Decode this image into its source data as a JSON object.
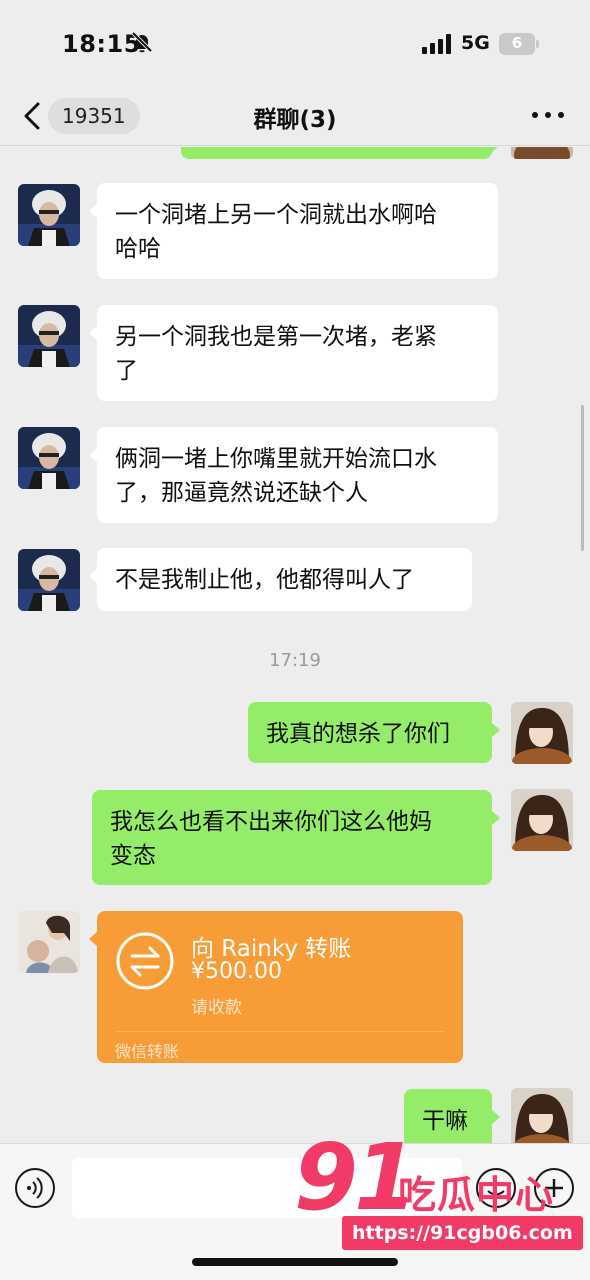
{
  "status_bar": {
    "time": "18:15",
    "network": "5G",
    "battery": "6",
    "icons": [
      "bell-slash-icon",
      "signal-bars-icon",
      "battery-icon"
    ]
  },
  "header": {
    "back_badge": "19351",
    "title": "群聊(3)",
    "more_icon": "ellipsis-icon"
  },
  "messages": [
    {
      "side": "left",
      "text": "一个洞堵上另一个洞就出水啊哈\n哈哈"
    },
    {
      "side": "left",
      "text": "另一个洞我也是第一次堵，老紧\n了"
    },
    {
      "side": "left",
      "text": "俩洞一堵上你嘴里就开始流口水\n了，那逼竟然说还缺个人"
    },
    {
      "side": "left",
      "text": "不是我制止他，他都得叫人了"
    },
    {
      "side": "center",
      "text": "17:19"
    },
    {
      "side": "right",
      "text": "我真的想杀了你们"
    },
    {
      "side": "right",
      "text": "我怎么也看不出来你们这么他妈\n变态"
    },
    {
      "side": "right",
      "text": "干嘛"
    }
  ],
  "transfer": {
    "title": "向 Rainky 转账",
    "amount": "¥500.00",
    "note": "请收款",
    "footer": "微信转账",
    "icon": "transfer-arrows-icon"
  },
  "input_bar": {
    "placeholder": "",
    "icons": [
      "voice-icon",
      "emoji-icon",
      "plus-icon"
    ]
  },
  "watermark": {
    "logo_number": "91",
    "logo_text": "吃瓜中心",
    "url": "https://91cgb06.com"
  },
  "colors": {
    "background": "#ededed",
    "bubble_left": "#ffffff",
    "bubble_right": "#95ec69",
    "transfer": "#f79c36",
    "watermark": "#f23a67"
  }
}
